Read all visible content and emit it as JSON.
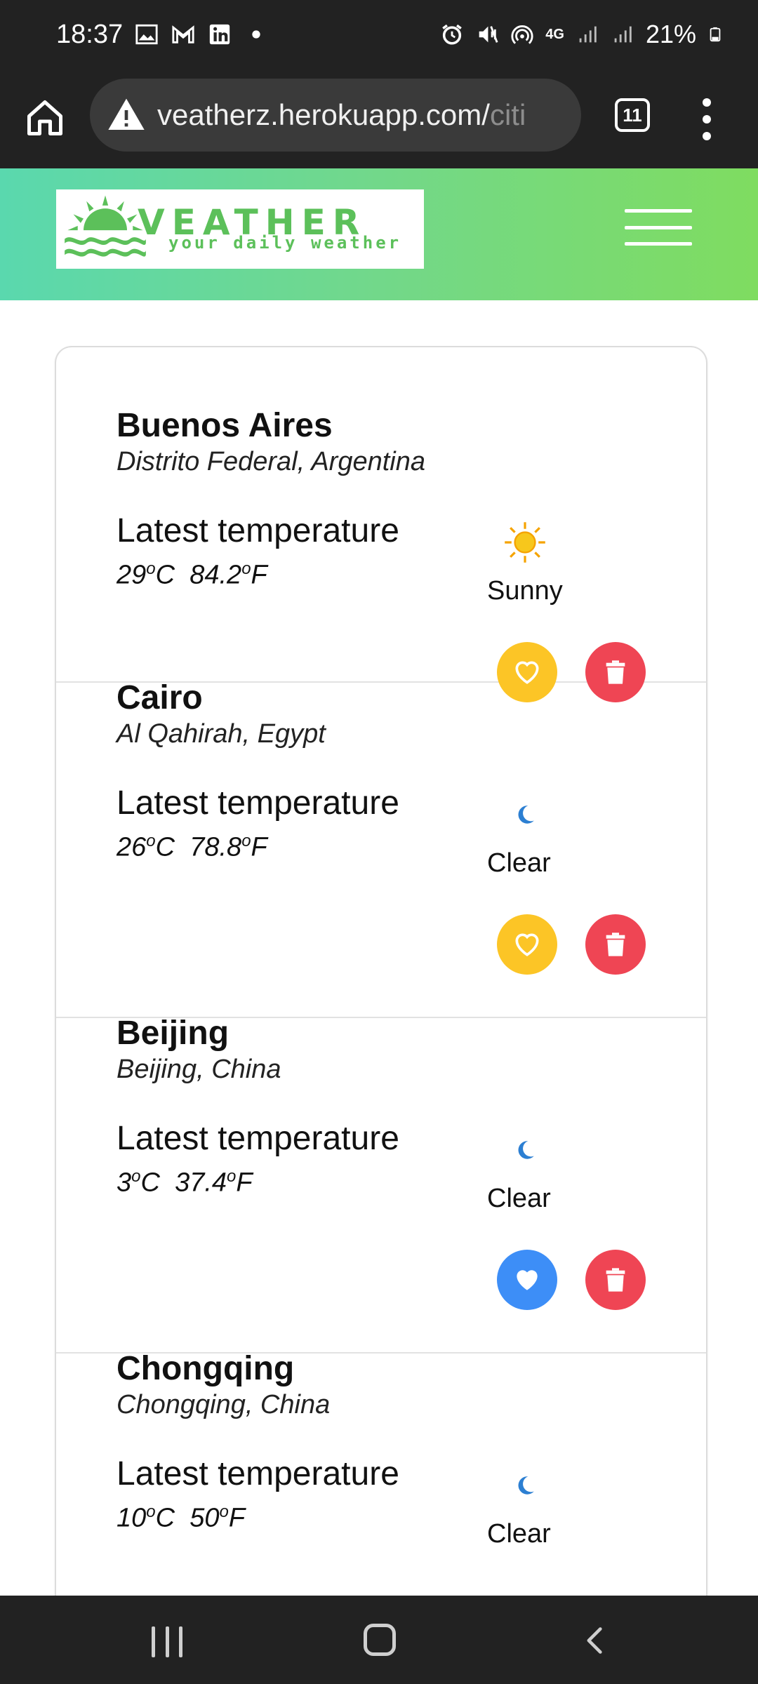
{
  "status_bar": {
    "time": "18:37",
    "battery": "21%",
    "left_icons": [
      "image-icon",
      "gmail-icon",
      "linkedin-icon",
      "dot-icon"
    ],
    "right_icons": [
      "alarm-icon",
      "mute-icon",
      "hotspot-icon",
      "4g-icon",
      "signal-icon",
      "signal-icon",
      "battery-icon"
    ],
    "network": "4G"
  },
  "browser": {
    "url_main": "veatherz.herokuapp.com/",
    "url_faded": "citi",
    "tab_count": "11"
  },
  "header": {
    "logo_title": "VEATHER",
    "logo_subtitle": "your daily weather"
  },
  "cities": [
    {
      "name": "Buenos Aires",
      "region": "Distrito Federal, Argentina",
      "latest_label": "Latest temperature",
      "temp_c": "29",
      "temp_f": "84.2",
      "condition": "Sunny",
      "condition_icon": "sun-icon",
      "favorite": false
    },
    {
      "name": "Cairo",
      "region": "Al Qahirah, Egypt",
      "latest_label": "Latest temperature",
      "temp_c": "26",
      "temp_f": "78.8",
      "condition": "Clear",
      "condition_icon": "moon-icon",
      "favorite": false
    },
    {
      "name": "Beijing",
      "region": "Beijing, China",
      "latest_label": "Latest temperature",
      "temp_c": "3",
      "temp_f": "37.4",
      "condition": "Clear",
      "condition_icon": "moon-icon",
      "favorite": true
    },
    {
      "name": "Chongqing",
      "region": "Chongqing, China",
      "latest_label": "Latest temperature",
      "temp_c": "10",
      "temp_f": "50",
      "condition": "Clear",
      "condition_icon": "moon-icon",
      "favorite": false
    }
  ],
  "units": {
    "deg": "o",
    "c": "C",
    "f": "F"
  },
  "colors": {
    "favorite_off": "#fcc526",
    "favorite_on": "#3d8ef7",
    "delete": "#ef4554",
    "header_gradient_start": "#5ad8ae",
    "header_gradient_end": "#7fdc60"
  }
}
